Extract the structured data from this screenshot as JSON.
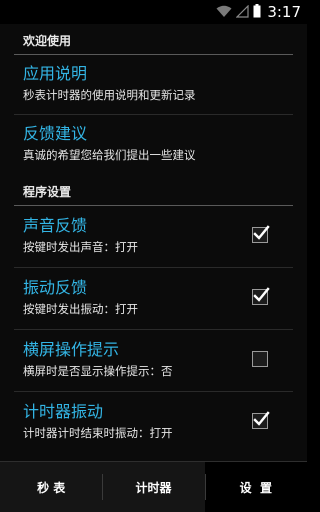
{
  "status_bar": {
    "time": "3:17",
    "icons": [
      "wifi-icon",
      "signal-icon",
      "battery-icon"
    ]
  },
  "sections": [
    {
      "header": "欢迎使用",
      "items": [
        {
          "title": "应用说明",
          "summary": "秒表计时器的使用说明和更新记录"
        },
        {
          "title": "反馈建议",
          "summary": "真诚的希望您给我们提出一些建议"
        }
      ]
    },
    {
      "header": "程序设置",
      "items": [
        {
          "title": "声音反馈",
          "summary": "按键时发出声音：打开",
          "checked": true
        },
        {
          "title": "振动反馈",
          "summary": "按键时发出振动：打开",
          "checked": true
        },
        {
          "title": "横屏操作提示",
          "summary": "横屏时是否显示操作提示：否",
          "checked": false
        },
        {
          "title": "计时器振动",
          "summary": "计时器计时结束时振动：打开",
          "checked": true
        }
      ]
    }
  ],
  "tabs": [
    {
      "label": "秒 表",
      "active": false
    },
    {
      "label": "计时器",
      "active": false
    },
    {
      "label": "设  置",
      "active": true
    }
  ],
  "colors": {
    "accent": "#33b5e5",
    "background": "#0b0b0b",
    "tab_bar": "#151515"
  }
}
